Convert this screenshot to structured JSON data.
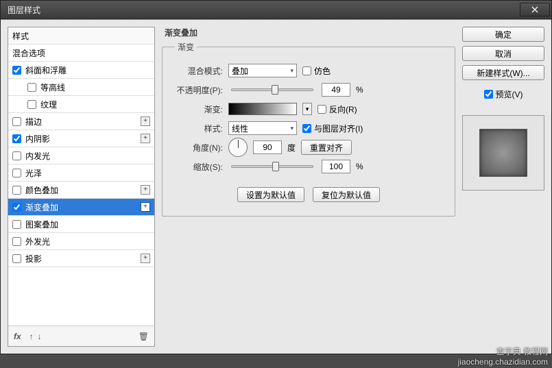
{
  "window": {
    "title": "图层样式"
  },
  "styles_panel": {
    "header": "样式",
    "blend_options": "混合选项",
    "items": [
      {
        "label": "斜面和浮雕",
        "checked": true,
        "plus": false,
        "sub": false
      },
      {
        "label": "等高线",
        "checked": false,
        "plus": false,
        "sub": true
      },
      {
        "label": "纹理",
        "checked": false,
        "plus": false,
        "sub": true
      },
      {
        "label": "描边",
        "checked": false,
        "plus": true,
        "sub": false
      },
      {
        "label": "内阴影",
        "checked": true,
        "plus": true,
        "sub": false
      },
      {
        "label": "内发光",
        "checked": false,
        "plus": false,
        "sub": false
      },
      {
        "label": "光泽",
        "checked": false,
        "plus": false,
        "sub": false
      },
      {
        "label": "颜色叠加",
        "checked": false,
        "plus": true,
        "sub": false
      },
      {
        "label": "渐变叠加",
        "checked": true,
        "plus": true,
        "sub": false,
        "selected": true
      },
      {
        "label": "图案叠加",
        "checked": false,
        "plus": false,
        "sub": false
      },
      {
        "label": "外发光",
        "checked": false,
        "plus": false,
        "sub": false
      },
      {
        "label": "投影",
        "checked": false,
        "plus": true,
        "sub": false
      }
    ],
    "footer_fx": "fx"
  },
  "main": {
    "title": "渐变叠加",
    "fieldset": "渐变",
    "blend_mode_label": "混合模式:",
    "blend_mode_value": "叠加",
    "dither_label": "仿色",
    "dither_checked": false,
    "opacity_label": "不透明度(P):",
    "opacity_value": "49",
    "opacity_unit": "%",
    "gradient_label": "渐变:",
    "reverse_label": "反向(R)",
    "reverse_checked": false,
    "style_label": "样式:",
    "style_value": "线性",
    "align_label": "与图层对齐(I)",
    "align_checked": true,
    "angle_label": "角度(N):",
    "angle_value": "90",
    "angle_unit": "度",
    "reset_align": "重置对齐",
    "scale_label": "缩放(S):",
    "scale_value": "100",
    "scale_unit": "%",
    "make_default": "设置为默认值",
    "reset_default": "复位为默认值"
  },
  "right": {
    "ok": "确定",
    "cancel": "取消",
    "new_style": "新建样式(W)...",
    "preview_label": "预览(V)",
    "preview_checked": true
  },
  "watermark": {
    "line1": "查字典 教程网",
    "line2": "jiaocheng.chazidian.com"
  }
}
